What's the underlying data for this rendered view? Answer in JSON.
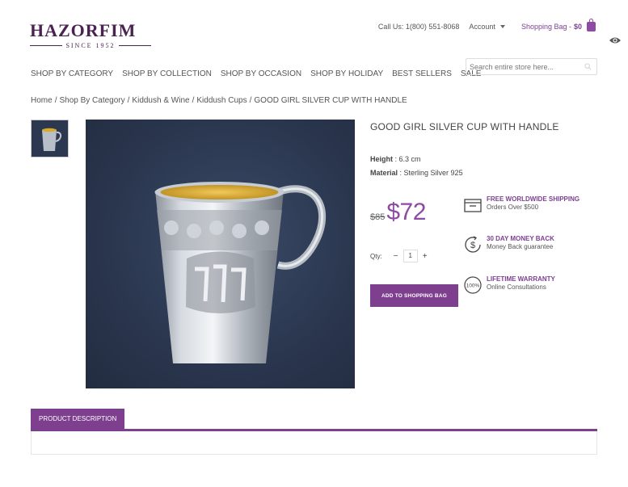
{
  "logo": {
    "name": "HAZORFIM",
    "since": "SINCE 1952"
  },
  "topbar": {
    "call": "Call Us: 1(800) 551-8068",
    "account": "Account",
    "bag_label": "Shopping Bag -",
    "bag_total": "$0"
  },
  "nav": [
    "SHOP BY CATEGORY",
    "SHOP BY COLLECTION",
    "SHOP BY OCCASION",
    "SHOP BY HOLIDAY",
    "BEST SELLERS",
    "SALE"
  ],
  "search": {
    "placeholder": "Search entire store here..."
  },
  "breadcrumb": [
    "Home",
    "Shop By Category",
    "Kiddush & Wine",
    "Kiddush Cups",
    "GOOD GIRL SILVER CUP WITH HANDLE"
  ],
  "breadcrumb_sep": "/",
  "product": {
    "title": "GOOD GIRL SILVER CUP WITH HANDLE",
    "height_label": "Height",
    "height_value": ": 6.3 cm",
    "material_label": "Material",
    "material_value": ": Sterling Silver 925",
    "old_price": "$85",
    "price": "$72",
    "qty_label": "Qty:",
    "qty_minus": "−",
    "qty_plus": "+",
    "qty_value": "1",
    "add_button": "ADD TO SHOPPING BAG"
  },
  "features": [
    {
      "icon": "box-icon",
      "title": "FREE WORLDWIDE SHIPPING",
      "sub": "Orders Over $500"
    },
    {
      "icon": "money-back-icon",
      "title": "30 DAY MONEY BACK",
      "sub": "Money Back guarantee"
    },
    {
      "icon": "warranty-icon",
      "title": "LIFETIME WARRANTY",
      "sub": "Online Consultations",
      "badge": "100%"
    }
  ],
  "tabs": {
    "description": "PRODUCT DESCRIPTION"
  },
  "colors": {
    "brand": "#7e3f8f",
    "logo": "#4a2350",
    "image_bg": "#2a364e"
  }
}
